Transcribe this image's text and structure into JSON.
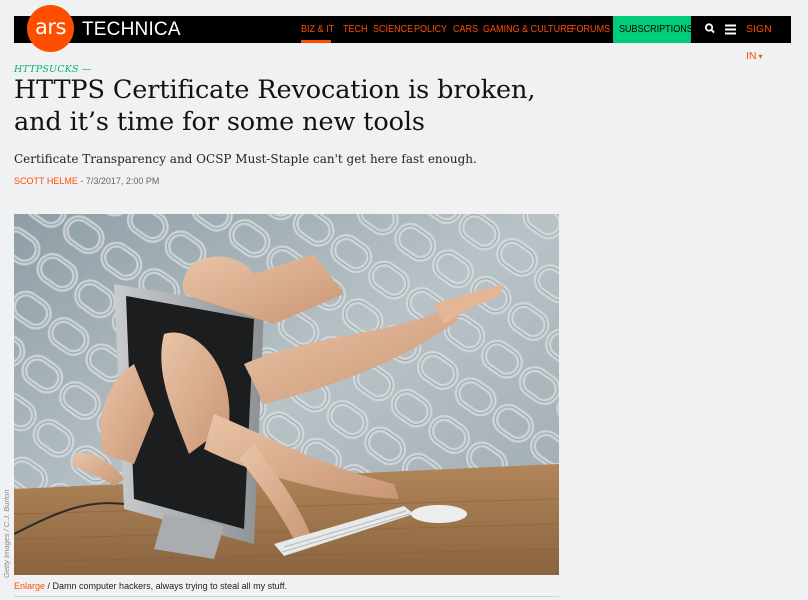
{
  "brand": {
    "logo_short": "ars",
    "logo_word": "TECHNICA",
    "accent": "#ff4e00",
    "subscribe_color": "#00cc7a"
  },
  "nav": {
    "items": [
      {
        "label": "BIZ & IT",
        "active": true
      },
      {
        "label": "TECH"
      },
      {
        "label": "SCIENCE"
      },
      {
        "label": "POLICY"
      },
      {
        "label": "CARS"
      },
      {
        "label": "GAMING & CULTURE"
      },
      {
        "label": "FORUMS"
      }
    ],
    "subscriptions": "SUBSCRIPTIONS",
    "search_icon": "search-icon",
    "menu_icon": "hamburger-menu-icon",
    "signin": "SIGN IN"
  },
  "article": {
    "kicker": "HTTPSUCKS —",
    "title": "HTTPS Certificate Revocation is broken, and it’s time for some new tools",
    "subtitle": "Certificate Transparency and OCSP Must-Staple can't get here fast enough.",
    "author": "SCOTT HELME",
    "date": "- 7/3/2017, 2:00 PM"
  },
  "hero": {
    "credit": "Getty Images / C.J. Burton",
    "enlarge": "Enlarge",
    "caption": " / Damn computer hackers, always trying to steal all my stuff."
  }
}
